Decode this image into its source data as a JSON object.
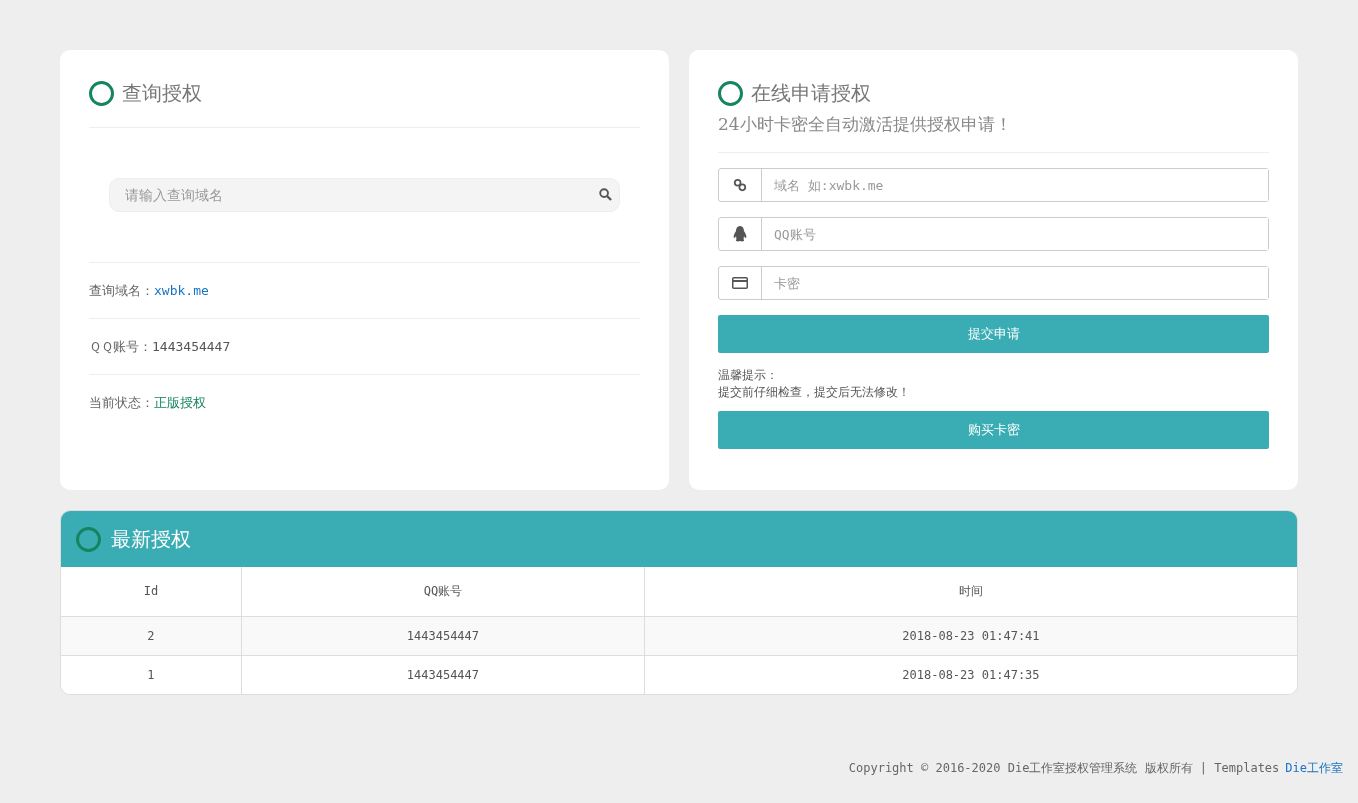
{
  "query_panel": {
    "title": "查询授权",
    "search": {
      "placeholder": "请输入查询域名"
    },
    "info": [
      {
        "label": "查询域名：",
        "value": "xwbk.me",
        "kind": "link"
      },
      {
        "label": "ＱＱ账号：",
        "value": "1443454447",
        "kind": "plain"
      },
      {
        "label": "当前状态：",
        "value": "正版授权",
        "kind": "status"
      }
    ]
  },
  "apply_panel": {
    "title": "在线申请授权",
    "subtitle": "24小时卡密全自动激活提供授权申请！",
    "fields": [
      {
        "kind": "link",
        "placeholder": "域名 如:xwbk.me"
      },
      {
        "kind": "qq",
        "placeholder": "QQ账号"
      },
      {
        "kind": "card",
        "placeholder": "卡密"
      }
    ],
    "submit": "提交申请",
    "tip_title": "温馨提示：",
    "tip": "提交前仔细检查，提交后无法修改！",
    "buy": "购买卡密"
  },
  "latest": {
    "title": "最新授权",
    "columns": [
      "Id",
      "QQ账号",
      "时间"
    ],
    "rows": [
      [
        "2",
        "1443454447",
        "2018-08-23 01:47:41"
      ],
      [
        "1",
        "1443454447",
        "2018-08-23 01:47:35"
      ]
    ]
  },
  "footer": {
    "text": "Copyright © 2016-2020 Die工作室授权管理系统 版权所有 | Templates",
    "link": "Die工作室"
  }
}
